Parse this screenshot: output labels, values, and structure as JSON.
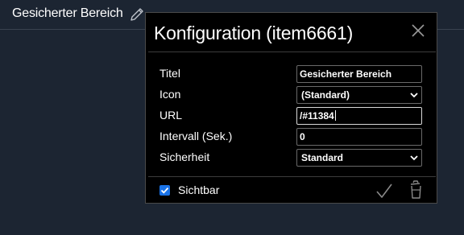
{
  "page": {
    "title": "Gesicherter Bereich"
  },
  "dialog": {
    "title": "Konfiguration (item6661)",
    "fields": {
      "titel": {
        "label": "Titel",
        "value": "Gesicherter Bereich"
      },
      "icon": {
        "label": "Icon",
        "value": "(Standard)"
      },
      "url": {
        "label": "URL",
        "value": "/#11384"
      },
      "intervall": {
        "label": "Intervall (Sek.)",
        "value": "0"
      },
      "sicherheit": {
        "label": "Sicherheit",
        "value": "Standard"
      }
    },
    "sichtbar": {
      "label": "Sichtbar",
      "checked": true
    }
  },
  "colors": {
    "background": "#1c2532",
    "dialog": "#000000",
    "checkbox": "#1a73e8"
  },
  "icons": [
    "edit-icon",
    "close-icon",
    "checkmark-icon",
    "trash-icon",
    "chevron-down-icon"
  ]
}
